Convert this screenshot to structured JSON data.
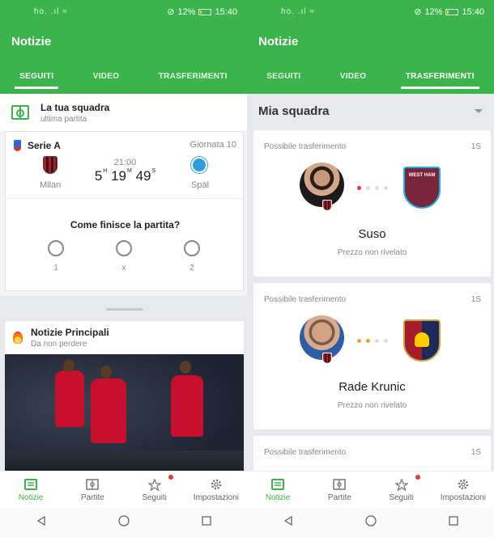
{
  "status": {
    "signal": "ho. .ıl ≈",
    "battery": "12%",
    "time": "15:40"
  },
  "app": {
    "title": "Notizie"
  },
  "tabs": [
    "SEGUITI",
    "VIDEO",
    "TRASFERIMENTI"
  ],
  "left": {
    "team": {
      "title": "La tua squadra",
      "subtitle": "ultima partita"
    },
    "match": {
      "league": "Serie A",
      "round": "Giornata 10",
      "home": "Milan",
      "away": "Spal",
      "kickoff": "21:00",
      "countdown": {
        "h": "5",
        "m": "19",
        "s": "49"
      },
      "question": "Come finisce la partita?",
      "options": [
        "1",
        "x",
        "2"
      ]
    },
    "news": {
      "title": "Notizie Principali",
      "subtitle": "Da non perdere"
    }
  },
  "right": {
    "dropdown": "Mia squadra",
    "transfers": [
      {
        "label": "Possibile trasferimento",
        "time": "1S",
        "player": "Suso",
        "price": "Prezzo non rivelato"
      },
      {
        "label": "Possibile trasferimento",
        "time": "1S",
        "player": "Rade Krunic",
        "price": "Prezzo non rivelato"
      },
      {
        "label": "Possibile trasferimento",
        "time": "1S"
      }
    ]
  },
  "bottomnav": [
    "Notizie",
    "Partite",
    "Seguiti",
    "Impostazioni"
  ],
  "colors": {
    "accent": "#3bb44c",
    "notification": "#e53935"
  }
}
